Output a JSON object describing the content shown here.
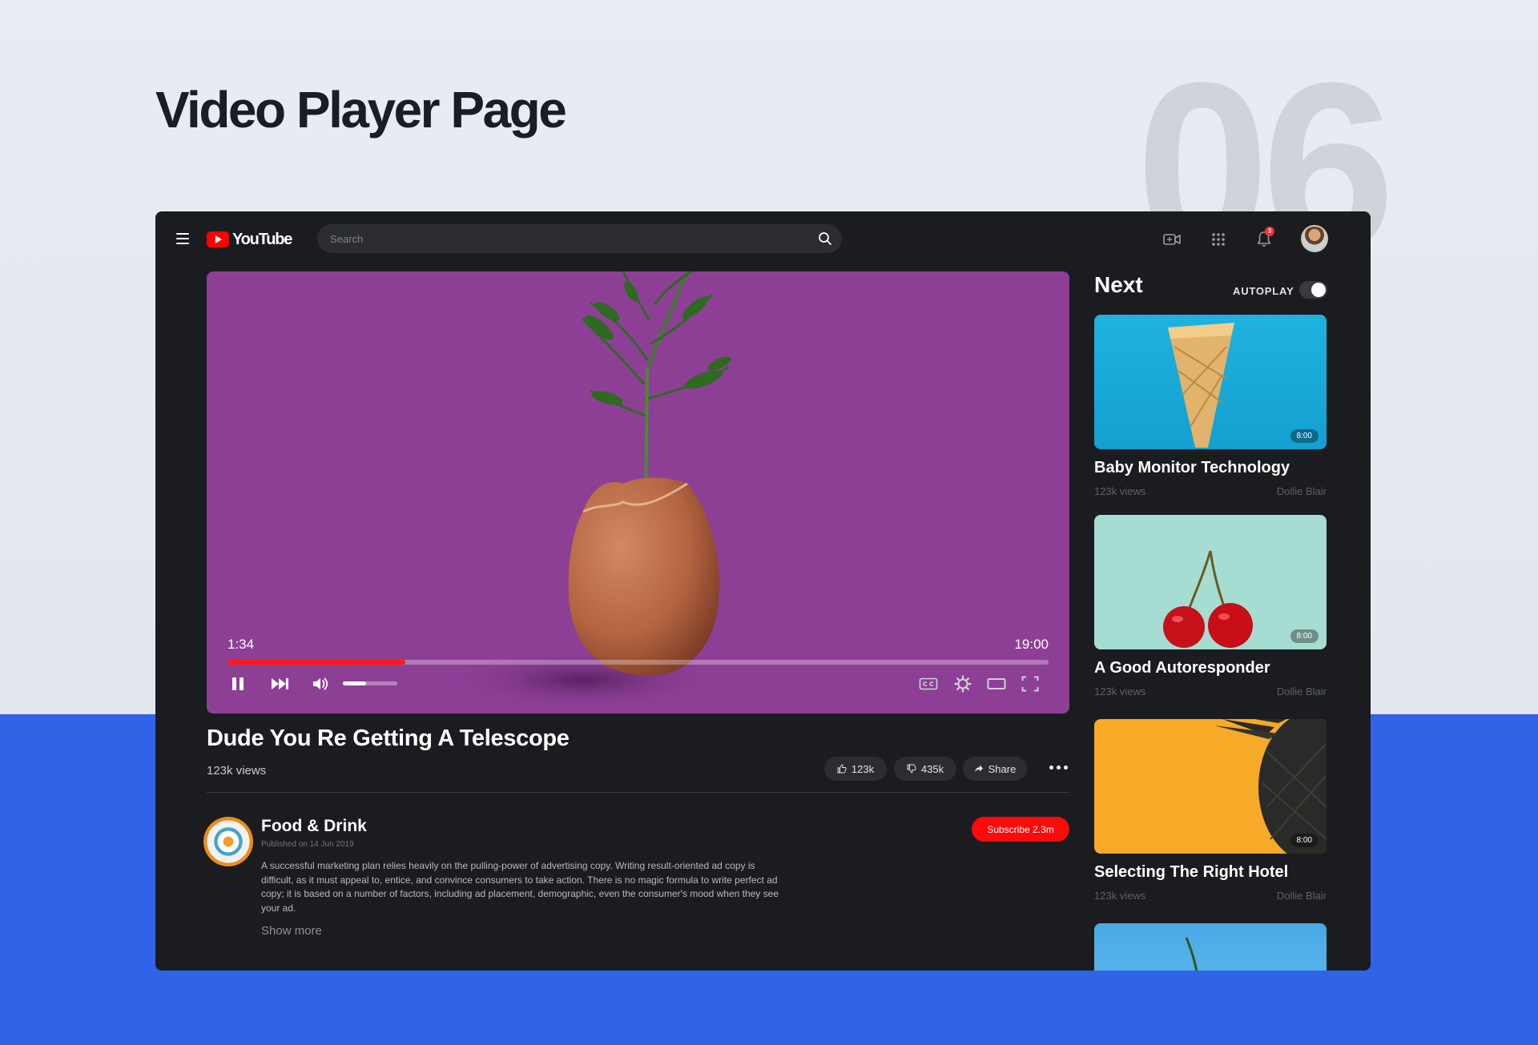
{
  "page": {
    "title": "Video Player Page",
    "number": "06"
  },
  "colors": {
    "accent_red": "#ff0a0a",
    "panel": "#1b1c20",
    "brand_blue": "#2f63e8"
  },
  "topbar": {
    "logo_text": "YouTube",
    "search": {
      "placeholder": "Search",
      "value": ""
    },
    "icons": [
      "menu-icon",
      "search-icon",
      "video-camera-icon",
      "apps-grid-icon",
      "bell-icon"
    ],
    "notification_count": "3"
  },
  "player": {
    "current_time": "1:34",
    "total_time": "19:00",
    "progress_fraction": 0.217,
    "volume_fraction": 0.42
  },
  "video": {
    "title": "Dude You Re Getting A Telescope",
    "views": "123k views",
    "likes": "123k",
    "dislikes": "435k",
    "share_label": "Share"
  },
  "channel": {
    "name": "Food & Drink",
    "published": "Published on 14 Jun 2019",
    "description": "A successful marketing plan relies heavily on the pulling-power of advertising copy. Writing result-oriented ad copy is difficult, as it must appeal to, entice, and convince consumers to take action. There is no magic formula to write perfect ad copy; it is based on a number of factors, including ad placement, demographic, even the consumer's mood when they see your ad.",
    "show_more": "Show more",
    "subscribe_label": "Subscribe 2.3m"
  },
  "up_next": {
    "title": "Next",
    "autoplay_label": "AUTOPLAY",
    "autoplay_on": true,
    "items": [
      {
        "title": "Baby Monitor Technology",
        "views": "123k views",
        "author": "Dollie Blair",
        "duration": "8:00"
      },
      {
        "title": "A Good Autoresponder",
        "views": "123k views",
        "author": "Dollie Blair",
        "duration": "8:00"
      },
      {
        "title": "Selecting The Right Hotel",
        "views": "123k views",
        "author": "Dollie Blair",
        "duration": "8:00"
      }
    ]
  }
}
